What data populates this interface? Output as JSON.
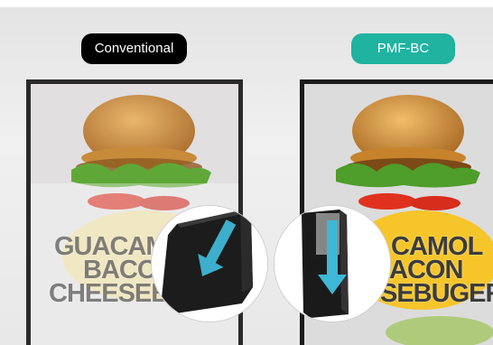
{
  "labels": {
    "conventional": "Conventional",
    "pmf": "PMF-BC"
  },
  "colors": {
    "conventional_badge": "#000000",
    "pmf_badge": "#1fb3a0",
    "arrow": "#3fb7d6"
  },
  "left_panel": {
    "lines": [
      "GUACAM",
      "BACO",
      "CHEESEB"
    ]
  },
  "right_panel": {
    "lines": [
      "CAMOL",
      "ACON",
      "SEBUGER"
    ]
  }
}
